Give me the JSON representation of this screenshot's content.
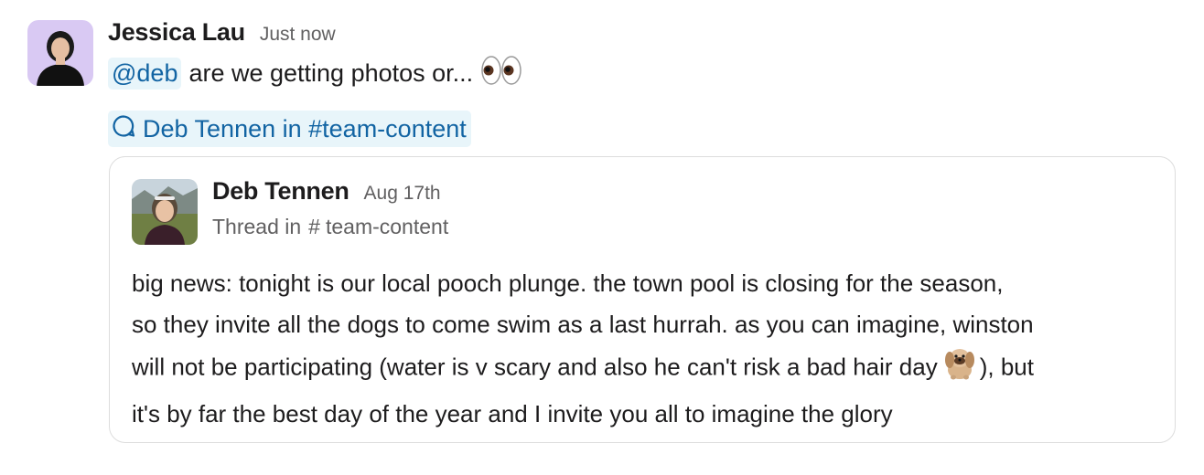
{
  "message": {
    "sender_name": "Jessica Lau",
    "timestamp": "Just now",
    "mention": "@deb",
    "text": "are we getting photos or...",
    "emoji": "eyes-emoji",
    "channel_link": "Deb Tennen in #team-content"
  },
  "shared_message": {
    "sender_name": "Deb Tennen",
    "date": "Aug 17th",
    "thread_prefix": "Thread in",
    "thread_hash": "#",
    "thread_channel": "team-content",
    "lines": [
      "big news: tonight is our local pooch plunge. the town pool is closing for the season,",
      "so they invite all the dogs to come swim as a last hurrah. as you can imagine, winston",
      "will not be participating (water is v scary and also he can't risk a bad hair day",
      "), but",
      "it's by far the best day of the year and I invite you all to imagine the glory"
    ],
    "emoji": "pekingese-dog-emoji"
  },
  "colors": {
    "link": "#1264a3",
    "link_bg": "#e8f5fa",
    "muted": "#616061",
    "text": "#1d1c1d",
    "border": "#dddddd"
  }
}
